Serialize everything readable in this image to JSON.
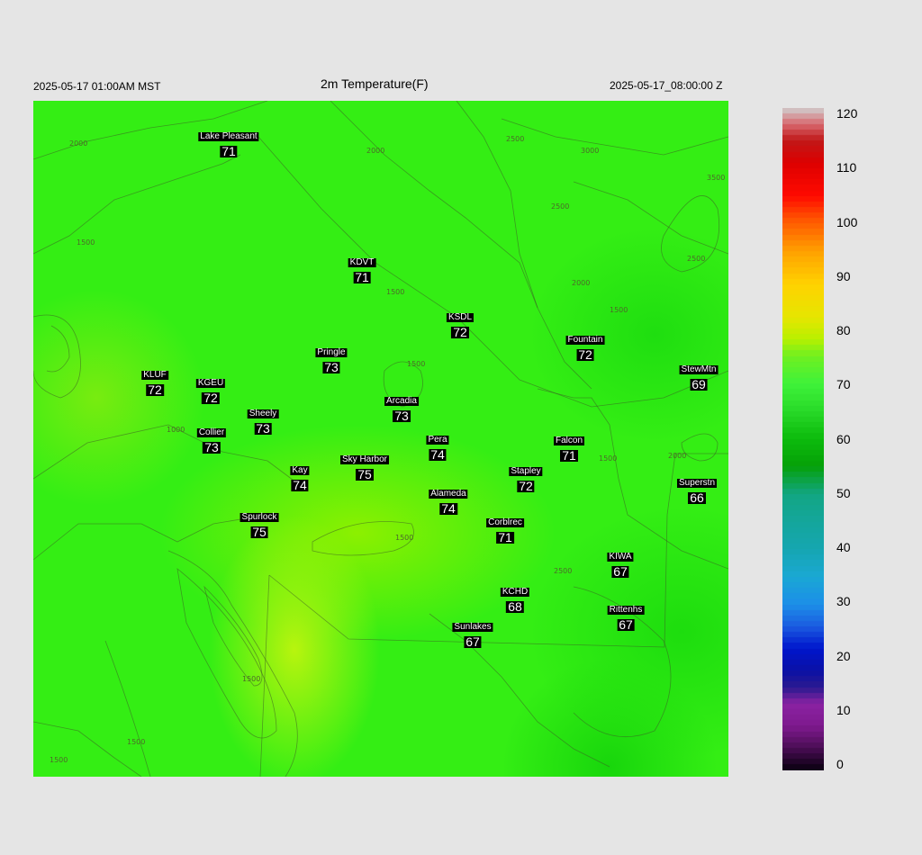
{
  "header": {
    "local_time": "2025-05-17 01:00AM MST",
    "title": "2m Temperature(F)",
    "utc_time": "2025-05-17_08:00:00 Z"
  },
  "stations": [
    {
      "name": "Lake Pleasant",
      "temp": "71"
    },
    {
      "name": "KDVT",
      "temp": "71"
    },
    {
      "name": "KSDL",
      "temp": "72"
    },
    {
      "name": "Fountain",
      "temp": "72"
    },
    {
      "name": "Pringle",
      "temp": "73"
    },
    {
      "name": "StewMtn",
      "temp": "69"
    },
    {
      "name": "KLUF",
      "temp": "72"
    },
    {
      "name": "KGEU",
      "temp": "72"
    },
    {
      "name": "Arcadia",
      "temp": "73"
    },
    {
      "name": "Sheely",
      "temp": "73"
    },
    {
      "name": "Collier",
      "temp": "73"
    },
    {
      "name": "Pera",
      "temp": "74"
    },
    {
      "name": "Falcon",
      "temp": "71"
    },
    {
      "name": "Sky Harbor",
      "temp": "75"
    },
    {
      "name": "Kay",
      "temp": "74"
    },
    {
      "name": "Stapley",
      "temp": "72"
    },
    {
      "name": "Superstn",
      "temp": "66"
    },
    {
      "name": "Alameda",
      "temp": "74"
    },
    {
      "name": "Spurlock",
      "temp": "75"
    },
    {
      "name": "Corblrec",
      "temp": "71"
    },
    {
      "name": "KIWA",
      "temp": "67"
    },
    {
      "name": "KCHD",
      "temp": "68"
    },
    {
      "name": "Rittenhs",
      "temp": "67"
    },
    {
      "name": "Sunlakes",
      "temp": "67"
    }
  ],
  "contour_labels": [
    "2000",
    "2000",
    "2500",
    "3000",
    "3500",
    "2500",
    "2500",
    "2000",
    "1500",
    "1500",
    "1500",
    "1500",
    "1000",
    "2000",
    "1500",
    "1500",
    "1500",
    "1500",
    "1500",
    "2500"
  ],
  "colorbar": {
    "ticks": [
      "120",
      "110",
      "100",
      "90",
      "80",
      "70",
      "60",
      "50",
      "40",
      "30",
      "20",
      "10",
      "0"
    ],
    "min": 0,
    "max": 120
  }
}
